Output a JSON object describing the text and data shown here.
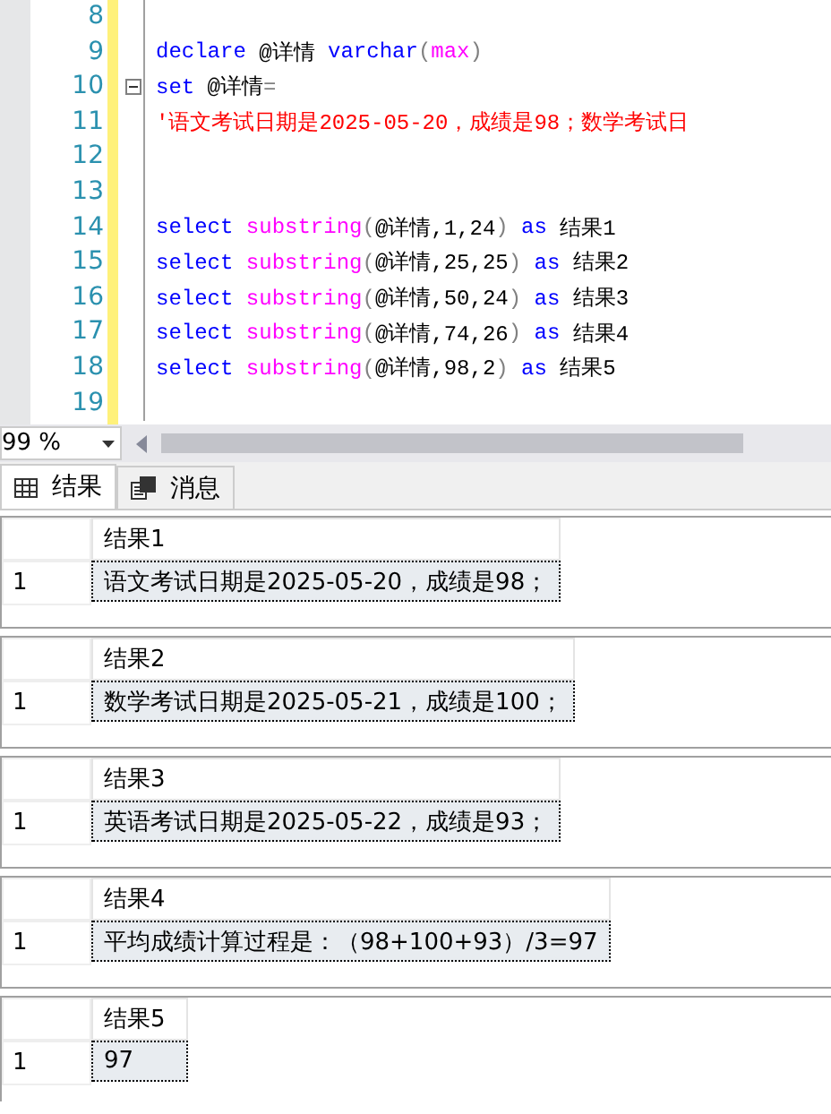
{
  "editor": {
    "lines": [
      {
        "number": "8",
        "fold": false
      },
      {
        "number": "9",
        "fold": false,
        "tokens": [
          {
            "text": "declare",
            "kind": "keyword"
          },
          {
            "text": " @详情 ",
            "kind": "plain"
          },
          {
            "text": "varchar",
            "kind": "keyword"
          },
          {
            "text": "(",
            "kind": "operator"
          },
          {
            "text": "max",
            "kind": "function"
          },
          {
            "text": ")",
            "kind": "operator"
          }
        ]
      },
      {
        "number": "10",
        "fold": true,
        "tokens": [
          {
            "text": "set",
            "kind": "keyword"
          },
          {
            "text": " @详情",
            "kind": "plain"
          },
          {
            "text": "=",
            "kind": "operator"
          }
        ]
      },
      {
        "number": "11",
        "fold": false,
        "tokens": [
          {
            "text": "'语文考试日期是2025-05-20，成绩是98；数学考试日",
            "kind": "string"
          }
        ]
      },
      {
        "number": "12",
        "fold": false
      },
      {
        "number": "13",
        "fold": false
      },
      {
        "number": "14",
        "fold": false,
        "tokens": [
          {
            "text": "select",
            "kind": "keyword"
          },
          {
            "text": " substring",
            "kind": "function"
          },
          {
            "text": "(",
            "kind": "operator"
          },
          {
            "text": "@详情,1,24",
            "kind": "plain"
          },
          {
            "text": ")",
            "kind": "operator"
          },
          {
            "text": " as",
            "kind": "keyword"
          },
          {
            "text": " 结果1",
            "kind": "plain"
          }
        ]
      },
      {
        "number": "15",
        "fold": false,
        "tokens": [
          {
            "text": "select",
            "kind": "keyword"
          },
          {
            "text": " substring",
            "kind": "function"
          },
          {
            "text": "(",
            "kind": "operator"
          },
          {
            "text": "@详情,25,25",
            "kind": "plain"
          },
          {
            "text": ")",
            "kind": "operator"
          },
          {
            "text": " as",
            "kind": "keyword"
          },
          {
            "text": " 结果2",
            "kind": "plain"
          }
        ]
      },
      {
        "number": "16",
        "fold": false,
        "tokens": [
          {
            "text": "select",
            "kind": "keyword"
          },
          {
            "text": " substring",
            "kind": "function"
          },
          {
            "text": "(",
            "kind": "operator"
          },
          {
            "text": "@详情,50,24",
            "kind": "plain"
          },
          {
            "text": ")",
            "kind": "operator"
          },
          {
            "text": " as",
            "kind": "keyword"
          },
          {
            "text": " 结果3",
            "kind": "plain"
          }
        ]
      },
      {
        "number": "17",
        "fold": false,
        "tokens": [
          {
            "text": "select",
            "kind": "keyword"
          },
          {
            "text": " substring",
            "kind": "function"
          },
          {
            "text": "(",
            "kind": "operator"
          },
          {
            "text": "@详情,74,26",
            "kind": "plain"
          },
          {
            "text": ")",
            "kind": "operator"
          },
          {
            "text": " as",
            "kind": "keyword"
          },
          {
            "text": " 结果4",
            "kind": "plain"
          }
        ]
      },
      {
        "number": "18",
        "fold": false,
        "tokens": [
          {
            "text": "select",
            "kind": "keyword"
          },
          {
            "text": " substring",
            "kind": "function"
          },
          {
            "text": "(",
            "kind": "operator"
          },
          {
            "text": "@详情,98,2",
            "kind": "plain"
          },
          {
            "text": ")",
            "kind": "operator"
          },
          {
            "text": " as",
            "kind": "keyword"
          },
          {
            "text": " 结果5",
            "kind": "plain"
          }
        ]
      },
      {
        "number": "19",
        "fold": false
      }
    ]
  },
  "zoom": {
    "value": "99 %"
  },
  "tabs": [
    {
      "label": "结果",
      "kind": "results",
      "selected": true
    },
    {
      "label": "消息",
      "kind": "messages",
      "selected": false
    }
  ],
  "results": [
    {
      "column": "结果1",
      "rows": [
        {
          "number": "1",
          "value": "语文考试日期是2025-05-20，成绩是98；",
          "selected": true
        }
      ]
    },
    {
      "column": "结果2",
      "rows": [
        {
          "number": "1",
          "value": "数学考试日期是2025-05-21，成绩是100；",
          "selected": true
        }
      ]
    },
    {
      "column": "结果3",
      "rows": [
        {
          "number": "1",
          "value": "英语考试日期是2025-05-22，成绩是93；",
          "selected": true
        }
      ]
    },
    {
      "column": "结果4",
      "rows": [
        {
          "number": "1",
          "value": "平均成绩计算过程是：（98+100+93）/3=97",
          "selected": true
        }
      ]
    },
    {
      "column": "结果5",
      "rows": [
        {
          "number": "1",
          "value": "97",
          "selected": true
        }
      ]
    }
  ]
}
